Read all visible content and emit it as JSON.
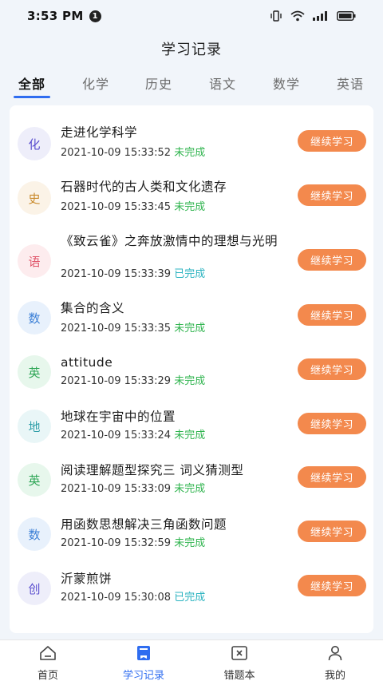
{
  "status_bar": {
    "time": "3:53 PM",
    "notification_count": "1",
    "icons": [
      "vibrate-icon",
      "wifi-icon",
      "signal-icon",
      "battery-icon"
    ]
  },
  "page": {
    "title": "学习记录"
  },
  "tabs": [
    {
      "label": "全部",
      "active": true
    },
    {
      "label": "化学",
      "active": false
    },
    {
      "label": "历史",
      "active": false
    },
    {
      "label": "语文",
      "active": false
    },
    {
      "label": "数学",
      "active": false
    },
    {
      "label": "英语",
      "active": false
    }
  ],
  "colors": {
    "accent": "#2f6df0",
    "button": "#f3894d",
    "status_done": "#2bb3c0",
    "status_todo": "#2fb44e"
  },
  "records": [
    {
      "subject": "化",
      "title": "走进化学科学",
      "time": "2021-10-09 15:33:52",
      "status": "未完成",
      "done": false,
      "button": "继续学习"
    },
    {
      "subject": "史",
      "title": "石器时代的古人类和文化遗存",
      "time": "2021-10-09 15:33:45",
      "status": "未完成",
      "done": false,
      "button": "继续学习"
    },
    {
      "subject": "语",
      "title": "《致云雀》之奔放激情中的理想与光明",
      "time": "2021-10-09 15:33:39",
      "status": "已完成",
      "done": true,
      "button": "继续学习"
    },
    {
      "subject": "数",
      "title": "集合的含义",
      "time": "2021-10-09 15:33:35",
      "status": "未完成",
      "done": false,
      "button": "继续学习"
    },
    {
      "subject": "英",
      "title": "attitude",
      "time": "2021-10-09 15:33:29",
      "status": "未完成",
      "done": false,
      "button": "继续学习"
    },
    {
      "subject": "地",
      "title": "地球在宇宙中的位置",
      "time": "2021-10-09 15:33:24",
      "status": "未完成",
      "done": false,
      "button": "继续学习"
    },
    {
      "subject": "英",
      "title": "阅读理解题型探究三 词义猜测型",
      "time": "2021-10-09 15:33:09",
      "status": "未完成",
      "done": false,
      "button": "继续学习"
    },
    {
      "subject": "数",
      "title": "用函数思想解决三角函数问题",
      "time": "2021-10-09 15:32:59",
      "status": "未完成",
      "done": false,
      "button": "继续学习"
    },
    {
      "subject": "创",
      "title": "沂蒙煎饼",
      "time": "2021-10-09 15:30:08",
      "status": "已完成",
      "done": true,
      "button": "继续学习"
    }
  ],
  "bottom_nav": [
    {
      "label": "首页",
      "icon": "home-icon",
      "active": false
    },
    {
      "label": "学习记录",
      "icon": "book-icon",
      "active": true
    },
    {
      "label": "错题本",
      "icon": "wrong-questions-icon",
      "active": false
    },
    {
      "label": "我的",
      "icon": "user-icon",
      "active": false
    }
  ]
}
